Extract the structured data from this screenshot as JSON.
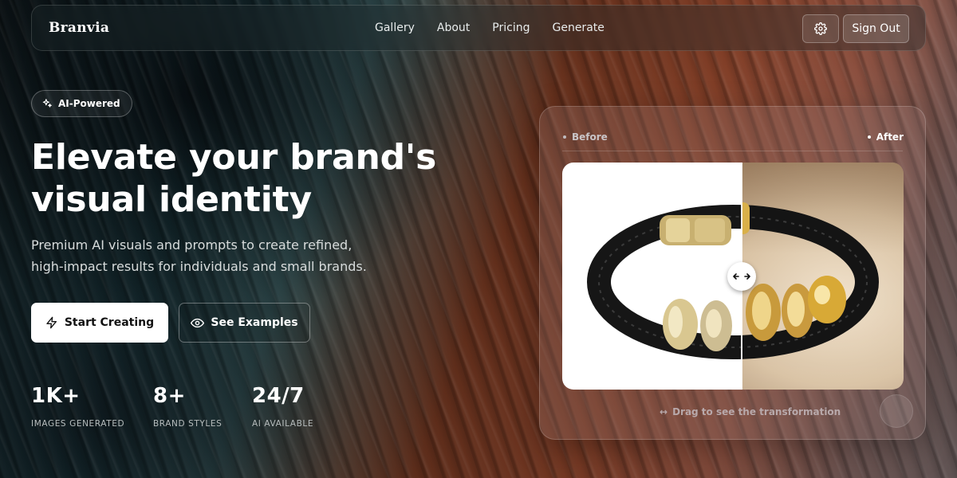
{
  "nav": {
    "brand": "Branvia",
    "links": [
      "Gallery",
      "About",
      "Pricing",
      "Generate"
    ],
    "settings_icon": "gear-icon",
    "sign_out": "Sign Out"
  },
  "hero": {
    "badge": "AI-Powered",
    "headline_line1": "Elevate your brand's",
    "headline_line2": "visual identity",
    "subtext": "Premium AI visuals and prompts to create refined, high-impact results for individuals and small brands.",
    "primary_cta": "Start Creating",
    "secondary_cta": "See Examples",
    "stats": [
      {
        "value": "1K+",
        "label": "IMAGES GENERATED"
      },
      {
        "value": "8+",
        "label": "BRAND STYLES"
      },
      {
        "value": "24/7",
        "label": "AI AVAILABLE"
      }
    ]
  },
  "comparison": {
    "before_label": "Before",
    "after_label": "After",
    "hint": "Drag to see the transformation",
    "hint_icon": "horizontal-arrows-icon"
  },
  "colors": {
    "accent_button_bg": "#ffffff",
    "text_primary": "#ffffff",
    "text_muted": "#b7bdbd"
  }
}
